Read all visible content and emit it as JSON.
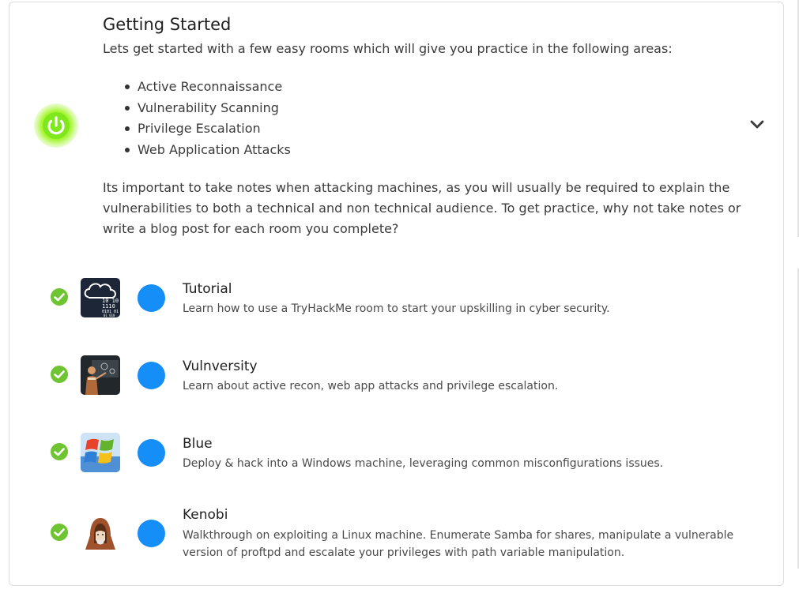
{
  "section": {
    "title": "Getting Started",
    "intro": "Lets get started with a few easy rooms which will give you practice in the following areas:",
    "areas": [
      "Active Reconnaissance",
      "Vulnerability Scanning",
      "Privilege Escalation",
      "Web Application Attacks"
    ],
    "notes": "Its important to take notes when attacking machines, as you will usually be required to explain the vulnerabilities to both a technical and non technical audience. To get practice, why not take notes or write a blog post for each room you complete?",
    "icon": "power-icon",
    "toggle_icon": "chevron-down-icon"
  },
  "rooms": [
    {
      "name": "Tutorial",
      "description": "Learn how to use a TryHackMe room to start your upskilling in cyber security.",
      "completed": true,
      "thumb_text": [
        "10 10",
        "1110",
        "0101 01",
        "01 010"
      ]
    },
    {
      "name": "Vulnversity",
      "description": "Learn about active recon, web app attacks and privilege escalation.",
      "completed": true
    },
    {
      "name": "Blue",
      "description": "Deploy & hack into a Windows machine, leveraging common misconfigurations issues.",
      "completed": true
    },
    {
      "name": "Kenobi",
      "description": "Walkthrough on exploiting a Linux machine. Enumerate Samba for shares, manipulate a vulnerable version of proftpd and escalate your privileges with path variable manipulation.",
      "completed": true
    }
  ],
  "colors": {
    "accent": "#168ef8",
    "check": "#6ec531",
    "power": "#a4f52e"
  }
}
